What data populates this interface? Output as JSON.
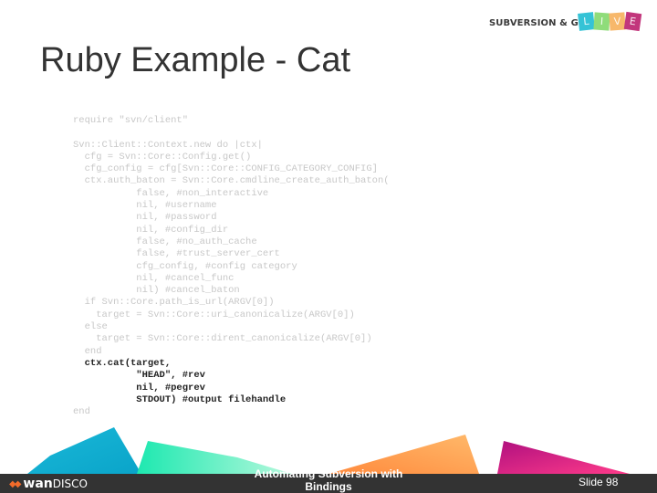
{
  "header": {
    "brand_text": "SUBVERSION & GIT",
    "live_letters": [
      "L",
      "I",
      "V",
      "E"
    ],
    "live_colors": [
      "#35c3d6",
      "#8fdc7a",
      "#f7b86b",
      "#c2367c"
    ]
  },
  "slide": {
    "title": "Ruby Example - Cat",
    "code_lines": [
      "require \"svn/client\"",
      "",
      "Svn::Client::Context.new do |ctx|",
      "  cfg = Svn::Core::Config.get()",
      "  cfg_config = cfg[Svn::Core::CONFIG_CATEGORY_CONFIG]",
      "  ctx.auth_baton = Svn::Core.cmdline_create_auth_baton(",
      "           false, #non_interactive",
      "           nil, #username",
      "           nil, #password",
      "           nil, #config_dir",
      "           false, #no_auth_cache",
      "           false, #trust_server_cert",
      "           cfg_config, #config category",
      "           nil, #cancel_func",
      "           nil) #cancel_baton",
      "  if Svn::Core.path_is_url(ARGV[0])",
      "    target = Svn::Core::uri_canonicalize(ARGV[0])",
      "  else",
      "    target = Svn::Core::dirent_canonicalize(ARGV[0])",
      "  end"
    ],
    "highlight_lines": [
      "  ctx.cat(target,",
      "           \"HEAD\", #rev",
      "           nil, #pegrev",
      "           STDOUT) #output filehandle"
    ],
    "end_line": "end"
  },
  "footer": {
    "logo_mark": "◆◆",
    "logo_bold": "wan",
    "logo_light": "DISCO",
    "title": "Automating Subversion with Bindings",
    "slide_number": "Slide 98"
  },
  "colors": {
    "footer_bg": "#333333",
    "title_text": "#333333",
    "code_faded": "#c8c8c8",
    "code_highlight": "#222222",
    "logo_accent": "#f26b2a"
  }
}
